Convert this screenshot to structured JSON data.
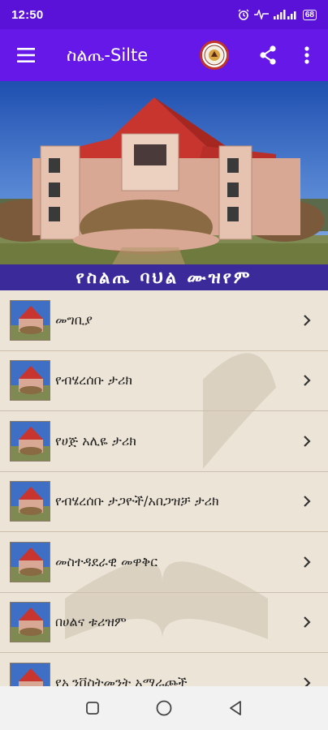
{
  "status_bar": {
    "time": "12:50",
    "battery": "68",
    "icons": [
      "alarm-icon",
      "activity-icon",
      "signal-icon",
      "battery-icon"
    ]
  },
  "app_bar": {
    "title": "ስልጤ-Silte",
    "menu_icon": "hamburger-icon",
    "logo": "app-logo",
    "share_icon": "share-icon",
    "more_icon": "more-vert-icon",
    "color": "#6618e8"
  },
  "banner": {
    "caption": "የስልጤ ባህል ሙዝየም"
  },
  "list": {
    "items": [
      {
        "label": "መግቢያ"
      },
      {
        "label": "የብሄረሰቡ ታሪክ"
      },
      {
        "label": "የሀጅ አሊዬ ታሪክ"
      },
      {
        "label": "የብሄረሰቡ ታጋዮች/አበጋዝቻ ታሪክ"
      },
      {
        "label": "መስተዳደራዊ መዋቅር"
      },
      {
        "label": "በሀልና ቱሪዝም"
      },
      {
        "label": "የኢንቨስትመንት አማራጮች"
      }
    ]
  },
  "nav_bar": {
    "buttons": [
      "recents-icon",
      "home-icon",
      "back-icon"
    ]
  }
}
